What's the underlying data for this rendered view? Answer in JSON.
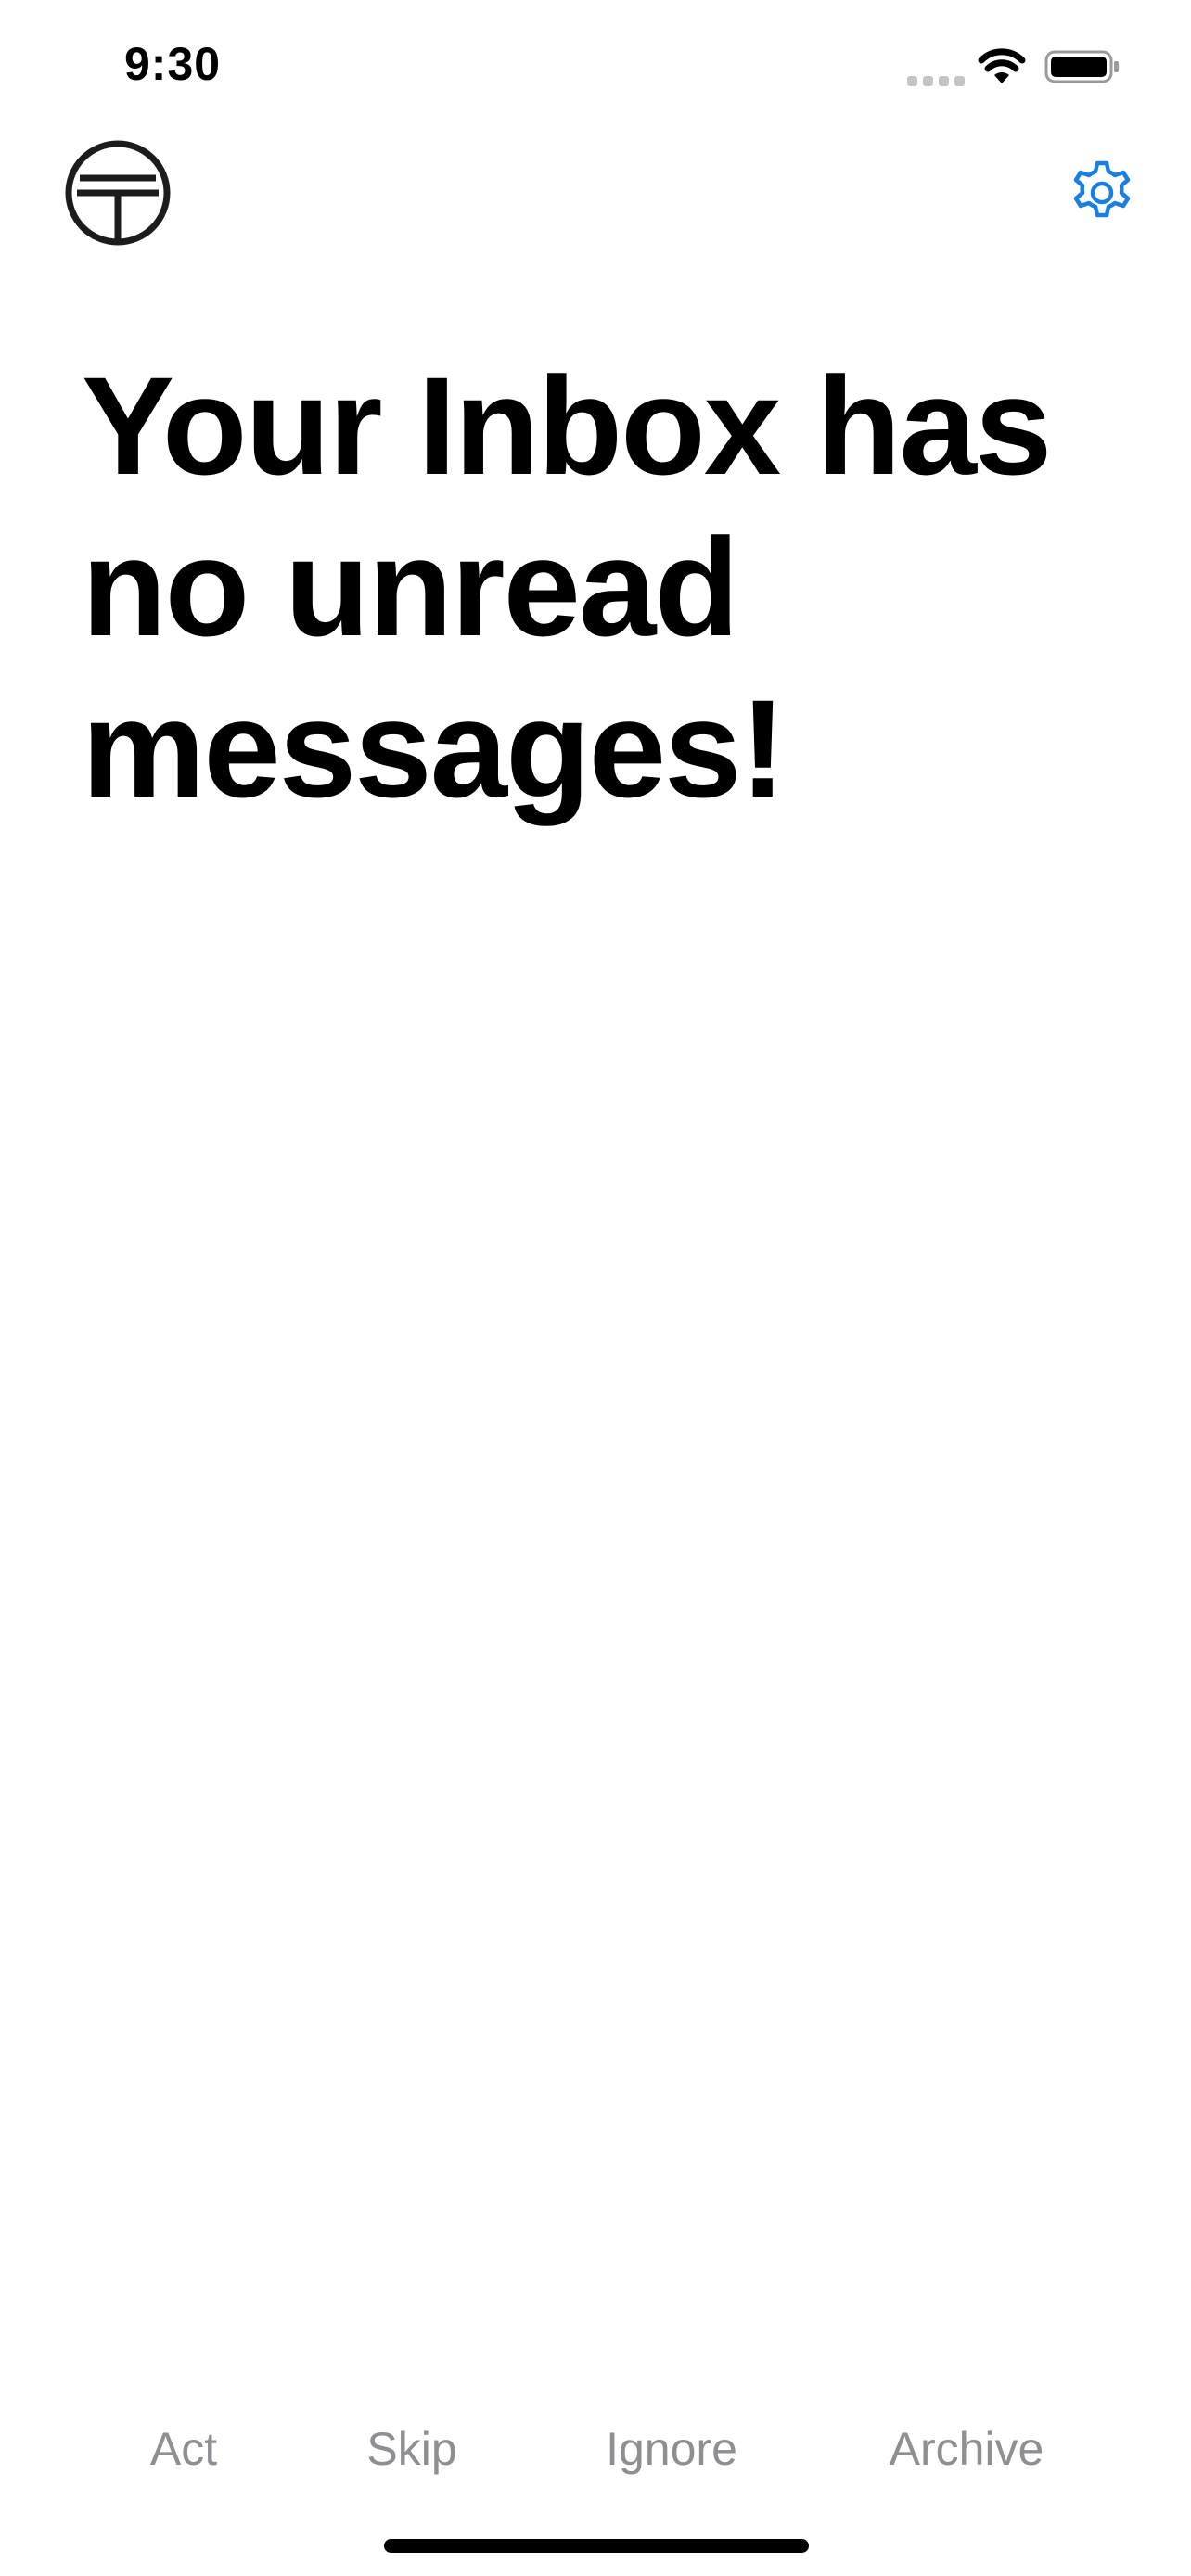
{
  "status_bar": {
    "time": "9:30",
    "signal_icon": "cellular-signal-icon",
    "wifi_icon": "wifi-icon",
    "battery_icon": "battery-icon"
  },
  "header": {
    "logo_icon": "app-logo-icon",
    "settings_icon": "gear-icon",
    "accent_color": "#1a7fe0"
  },
  "main": {
    "headline": "Your Inbox has no unread messages!"
  },
  "actions": {
    "color": "#8e8e93",
    "items": [
      {
        "label": "Act"
      },
      {
        "label": "Skip"
      },
      {
        "label": "Ignore"
      },
      {
        "label": "Archive"
      }
    ]
  }
}
